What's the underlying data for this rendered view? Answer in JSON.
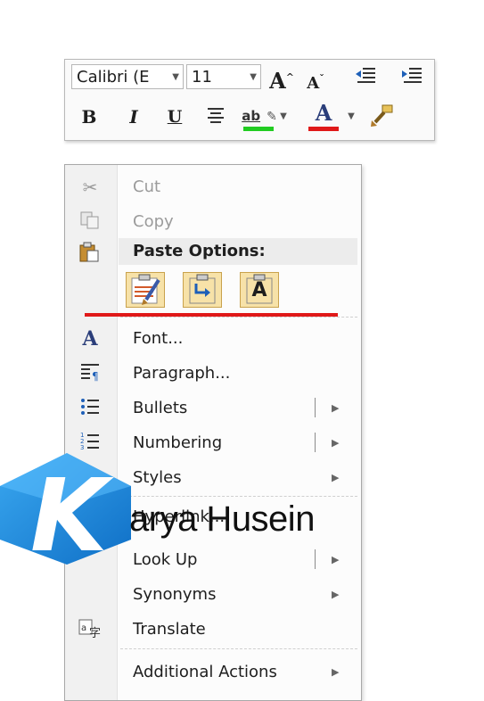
{
  "mini_toolbar": {
    "font_name": "Calibri (E",
    "font_size": "11",
    "grow_font": "A",
    "shrink_font": "A",
    "bold": "B",
    "italic": "I",
    "underline": "U",
    "font_color": "A",
    "highlight_text": "ab",
    "colors": {
      "highlight": "#22cc22",
      "font_color": "#e01919"
    }
  },
  "context_menu": {
    "items": [
      {
        "label": "Cut",
        "enabled": false
      },
      {
        "label": "Copy",
        "enabled": false
      },
      {
        "label": "Font...",
        "enabled": true
      },
      {
        "label": "Paragraph...",
        "enabled": true
      },
      {
        "label": "Bullets",
        "enabled": true,
        "split": true
      },
      {
        "label": "Numbering",
        "enabled": true,
        "split": true
      },
      {
        "label": "Styles",
        "enabled": true
      },
      {
        "label": "Hyperlink...",
        "enabled": true
      },
      {
        "label": "Look Up",
        "enabled": true,
        "split": true
      },
      {
        "label": "Synonyms",
        "enabled": true
      },
      {
        "label": "Translate",
        "enabled": true
      },
      {
        "label": "Additional Actions",
        "enabled": true
      }
    ],
    "paste_options": {
      "header": "Paste Options:",
      "buttons": [
        "keep-source-formatting",
        "merge-formatting",
        "keep-text-only"
      ],
      "text_only_glyph": "A"
    }
  },
  "watermark": {
    "letter": "K",
    "text": "arya Husein",
    "color": "#1e88d8"
  }
}
